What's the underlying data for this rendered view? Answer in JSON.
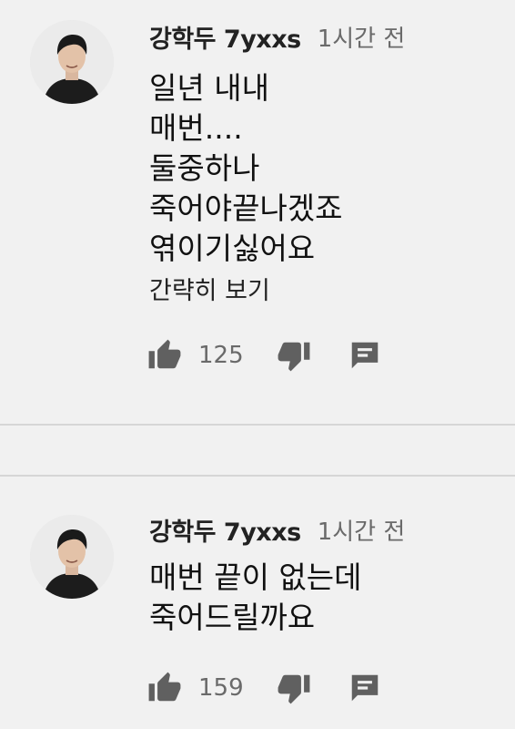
{
  "comments": [
    {
      "author": "강학두 7yxxs",
      "time": "1시간 전",
      "lines": [
        "일년 내내",
        "매번....",
        "둘중하나",
        "죽어야끝나겠죠",
        "엮이기싫어요"
      ],
      "show_less": "간략히 보기",
      "likes": "125"
    },
    {
      "author": "강학두 7yxxs",
      "time": "1시간 전",
      "lines": [
        "매번 끝이 없는데",
        "죽어드릴까요"
      ],
      "likes": "159"
    }
  ],
  "colors": {
    "background": "#f1f1f1",
    "icon": "#606060",
    "muted_text": "#6a6a6a",
    "divider": "#d6d6d6"
  },
  "icons": [
    "avatar",
    "thumbs-up-icon",
    "thumbs-down-icon",
    "reply-icon"
  ]
}
